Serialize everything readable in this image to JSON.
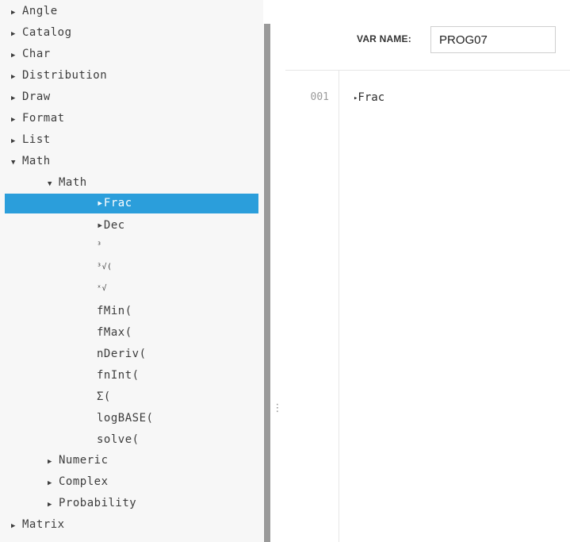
{
  "tree": {
    "items": [
      {
        "label": "Angle",
        "level": 0,
        "expanded": false
      },
      {
        "label": "Catalog",
        "level": 0,
        "expanded": false
      },
      {
        "label": "Char",
        "level": 0,
        "expanded": false
      },
      {
        "label": "Distribution",
        "level": 0,
        "expanded": false
      },
      {
        "label": "Draw",
        "level": 0,
        "expanded": false
      },
      {
        "label": "Format",
        "level": 0,
        "expanded": false
      },
      {
        "label": "List",
        "level": 0,
        "expanded": false
      },
      {
        "label": "Math",
        "level": 0,
        "expanded": true
      },
      {
        "label": "Math",
        "level": 1,
        "expanded": true
      },
      {
        "label": "▸Frac",
        "level": 2,
        "selected": true
      },
      {
        "label": "▸Dec",
        "level": 2
      },
      {
        "label": "³",
        "level": 2
      },
      {
        "label": "³√(",
        "level": 2
      },
      {
        "label": "ˣ√",
        "level": 2
      },
      {
        "label": "fMin(",
        "level": 2
      },
      {
        "label": "fMax(",
        "level": 2
      },
      {
        "label": "nDeriv(",
        "level": 2
      },
      {
        "label": "fnInt(",
        "level": 2
      },
      {
        "label": "Σ(",
        "level": 2
      },
      {
        "label": "logBASE(",
        "level": 2
      },
      {
        "label": "solve(",
        "level": 2
      },
      {
        "label": "Numeric",
        "level": 1,
        "expanded": false
      },
      {
        "label": "Complex",
        "level": 1,
        "expanded": false
      },
      {
        "label": "Probability",
        "level": 1,
        "expanded": false
      },
      {
        "label": "Matrix",
        "level": 0,
        "expanded": false
      }
    ],
    "triangle_collapsed": "▶",
    "triangle_expanded": "▼"
  },
  "splitter": {
    "dots": "⋮"
  },
  "editor": {
    "var_name_label": "VAR NAME:",
    "var_name_value": "PROG07",
    "lines": [
      {
        "number": "001",
        "code": "Frac",
        "prefix": "▸"
      }
    ]
  },
  "colors": {
    "selection": "#2b9edb",
    "tree_bg": "#f7f7f7",
    "scrollbar": "#9a9a9a"
  }
}
